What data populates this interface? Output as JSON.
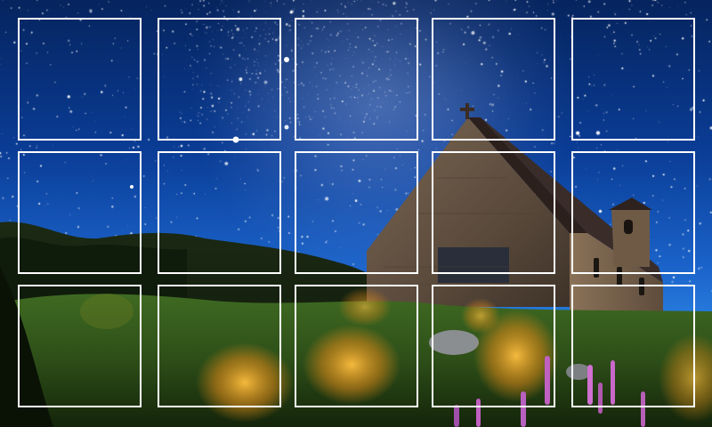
{
  "grid": {
    "rows": 3,
    "cols": 5,
    "tiles": [
      {
        "row": 1,
        "col": 1
      },
      {
        "row": 1,
        "col": 2
      },
      {
        "row": 1,
        "col": 3
      },
      {
        "row": 1,
        "col": 4
      },
      {
        "row": 1,
        "col": 5
      },
      {
        "row": 2,
        "col": 1
      },
      {
        "row": 2,
        "col": 2
      },
      {
        "row": 2,
        "col": 3
      },
      {
        "row": 2,
        "col": 4
      },
      {
        "row": 2,
        "col": 5
      },
      {
        "row": 3,
        "col": 1
      },
      {
        "row": 3,
        "col": 2
      },
      {
        "row": 3,
        "col": 3
      },
      {
        "row": 3,
        "col": 4
      },
      {
        "row": 3,
        "col": 5
      }
    ]
  },
  "colors": {
    "sky_top": "#06245e",
    "sky_bottom": "#3a98f0",
    "tile_border": "#ffffff",
    "church_stone": "#6b5a48",
    "roof": "#3a2c28",
    "grass_glow": "#f0a020",
    "lupin": "#c060c0"
  }
}
